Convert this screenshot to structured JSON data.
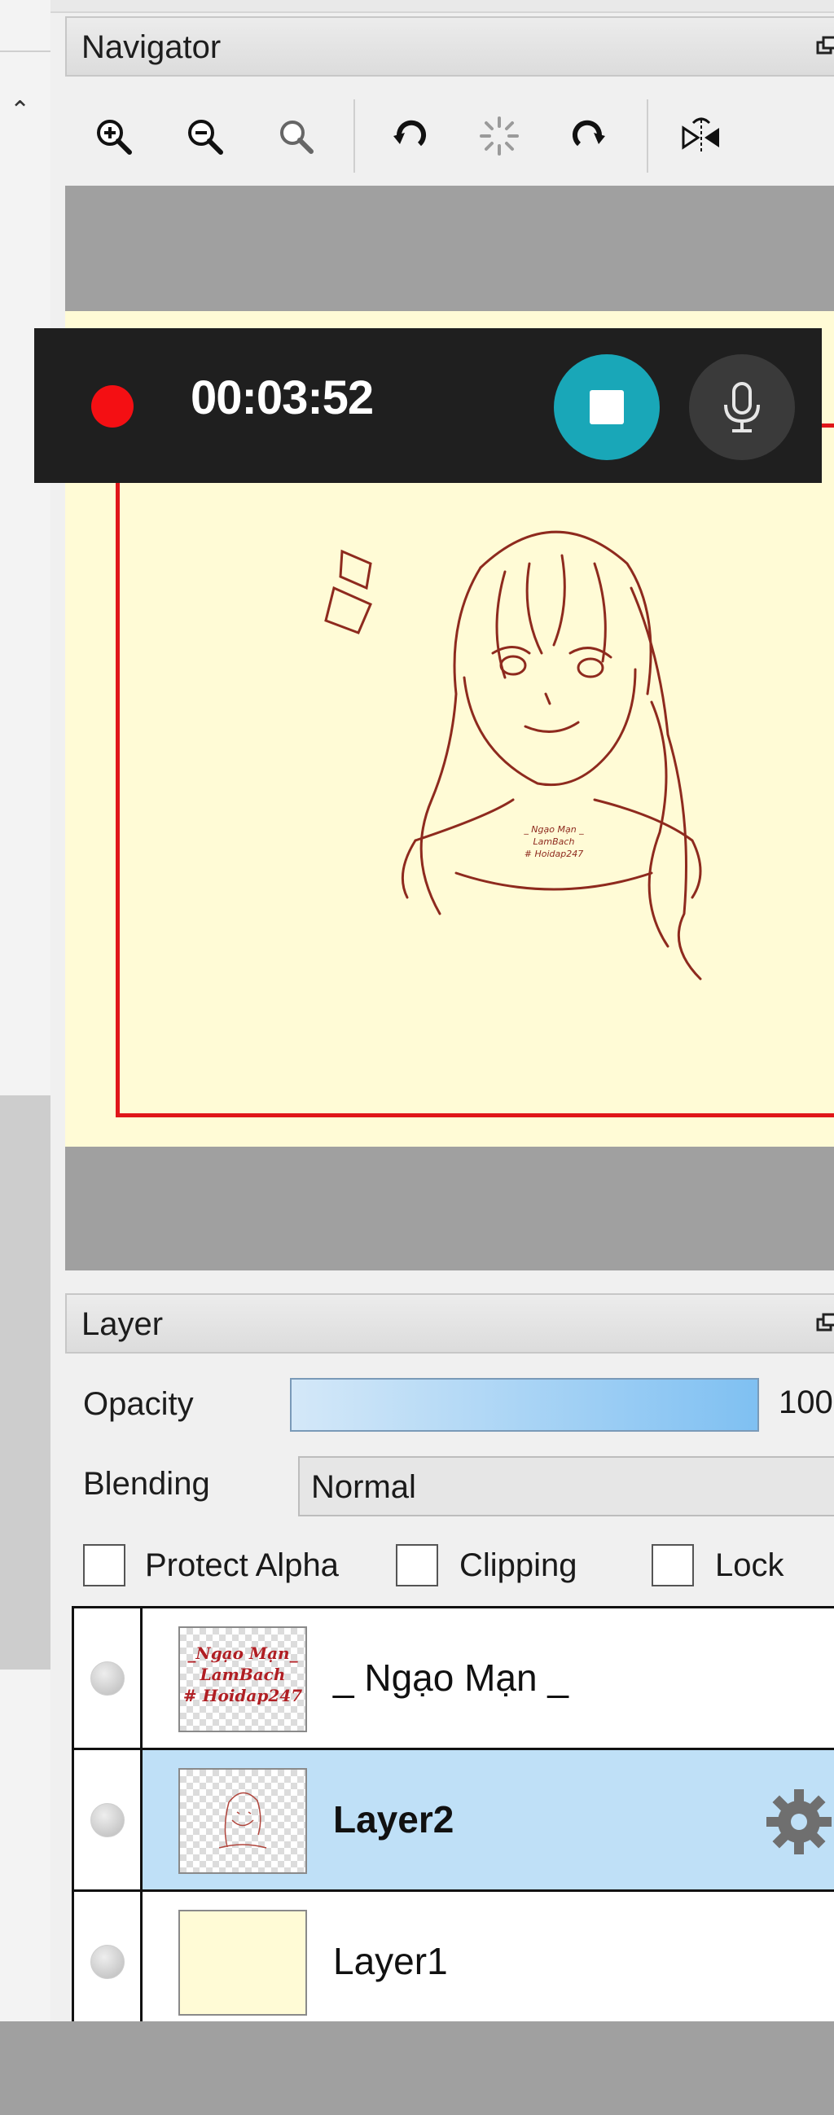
{
  "navigator": {
    "title": "Navigator",
    "toolbar": {
      "zoom_in_icon": "zoom-in-icon",
      "zoom_out_icon": "zoom-out-icon",
      "zoom_reset_icon": "zoom-reset-icon",
      "rotate_left_icon": "rotate-left-icon",
      "rotate_reset_icon": "rotate-reset-icon",
      "rotate_right_icon": "rotate-right-icon",
      "flip_icon": "flip-horizontal-icon"
    },
    "canvas_color": "#fffbd6",
    "frame_color": "#e0161a",
    "artwork_signature": "_ Ngạo Mạn _ LamBach # Hoidap247"
  },
  "recorder": {
    "time": "00:03:52",
    "record_indicator_color": "#f40f13",
    "stop_button_color": "#19a7b8",
    "mic_icon": "microphone-icon"
  },
  "layer_panel": {
    "title": "Layer",
    "opacity_label": "Opacity",
    "opacity_value": "100",
    "opacity_fraction": 1.0,
    "blending_label": "Blending",
    "blending_value": "Normal",
    "protect_alpha_label": "Protect Alpha",
    "clipping_label": "Clipping",
    "lock_label": "Lock",
    "layers": [
      {
        "name": "_ Ngạo Mạn _",
        "thumb_text": "_Ngạo Mạn_ LamBach # Hoidap247",
        "selected": false
      },
      {
        "name": "Layer2",
        "selected": true,
        "settings_icon": "gear-icon"
      },
      {
        "name": "Layer1",
        "selected": false
      }
    ]
  }
}
